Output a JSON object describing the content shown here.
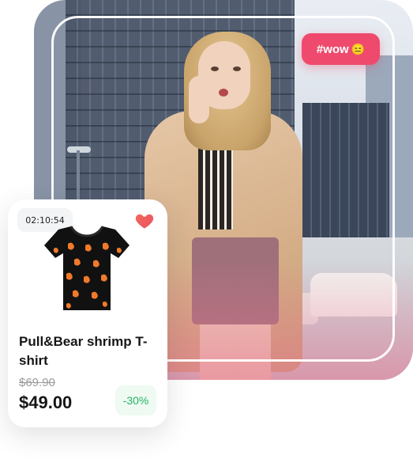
{
  "hero": {
    "tag_label": "#wow",
    "tag_emoji": "😑",
    "accent_color": "#ef4a6e"
  },
  "product": {
    "timer": "02:10:54",
    "favorite_icon": "heart-icon",
    "image_icon": "tshirt-image",
    "title": "Pull&Bear shrimp T-shirt",
    "old_price": "$69.90",
    "price": "$49.00",
    "discount": "-30%",
    "discount_color": "#27b364",
    "heart_color": "#ef5a4a"
  }
}
